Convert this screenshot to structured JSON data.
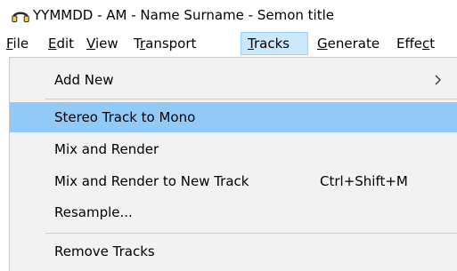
{
  "window": {
    "title": "YYMMDD - AM - Name Surname - Semon title",
    "app_icon": "headphones-icon",
    "accent_color": "#ffc83d"
  },
  "menubar": {
    "items": [
      {
        "label": "File",
        "mnemonic": "F"
      },
      {
        "label": "Edit",
        "mnemonic": "E"
      },
      {
        "label": "View",
        "mnemonic": "V"
      },
      {
        "label": "Transport",
        "mnemonic": "r"
      },
      {
        "label": "Tracks",
        "mnemonic": "T",
        "active": true
      },
      {
        "label": "Generate",
        "mnemonic": "G"
      },
      {
        "label": "Effect",
        "mnemonic": "c"
      }
    ]
  },
  "tracks_menu": {
    "items": [
      {
        "label": "Add New",
        "submenu": true,
        "submenu_icon": "chevron-right-icon"
      },
      {
        "label": "Stereo Track to Mono",
        "highlighted": true
      },
      {
        "label": "Mix and Render"
      },
      {
        "label": "Mix and Render to New Track",
        "shortcut": "Ctrl+Shift+M"
      },
      {
        "label": "Resample..."
      },
      {
        "label": "Remove Tracks"
      }
    ],
    "highlight_color": "#91c9f7",
    "background_color": "#f2f2f2"
  }
}
